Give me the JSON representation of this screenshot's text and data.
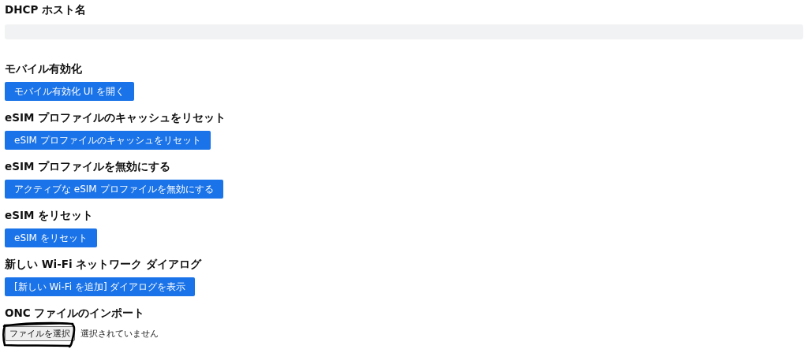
{
  "dhcp": {
    "heading": "DHCP ホスト名",
    "value_field": {
      "kind": "field"
    }
  },
  "sections": [
    {
      "heading": "モバイル有効化",
      "button": "モバイル有効化 UI を開く"
    },
    {
      "heading": "eSIM プロファイルのキャッシュをリセット",
      "button": "eSIM プロファイルのキャッシュをリセット"
    },
    {
      "heading": "eSIM プロファイルを無効にする",
      "button": "アクティブな eSIM プロファイルを無効にする"
    },
    {
      "heading": "eSIM をリセット",
      "button": "eSIM をリセット"
    },
    {
      "heading": "新しい Wi-Fi ネットワーク ダイアログ",
      "button": "[新しい Wi-Fi を追加] ダイアログを表示"
    }
  ],
  "onc_import": {
    "heading": "ONC ファイルのインポート",
    "choose_button": "ファイルを選択",
    "status": "選択されていません",
    "circled": true
  }
}
